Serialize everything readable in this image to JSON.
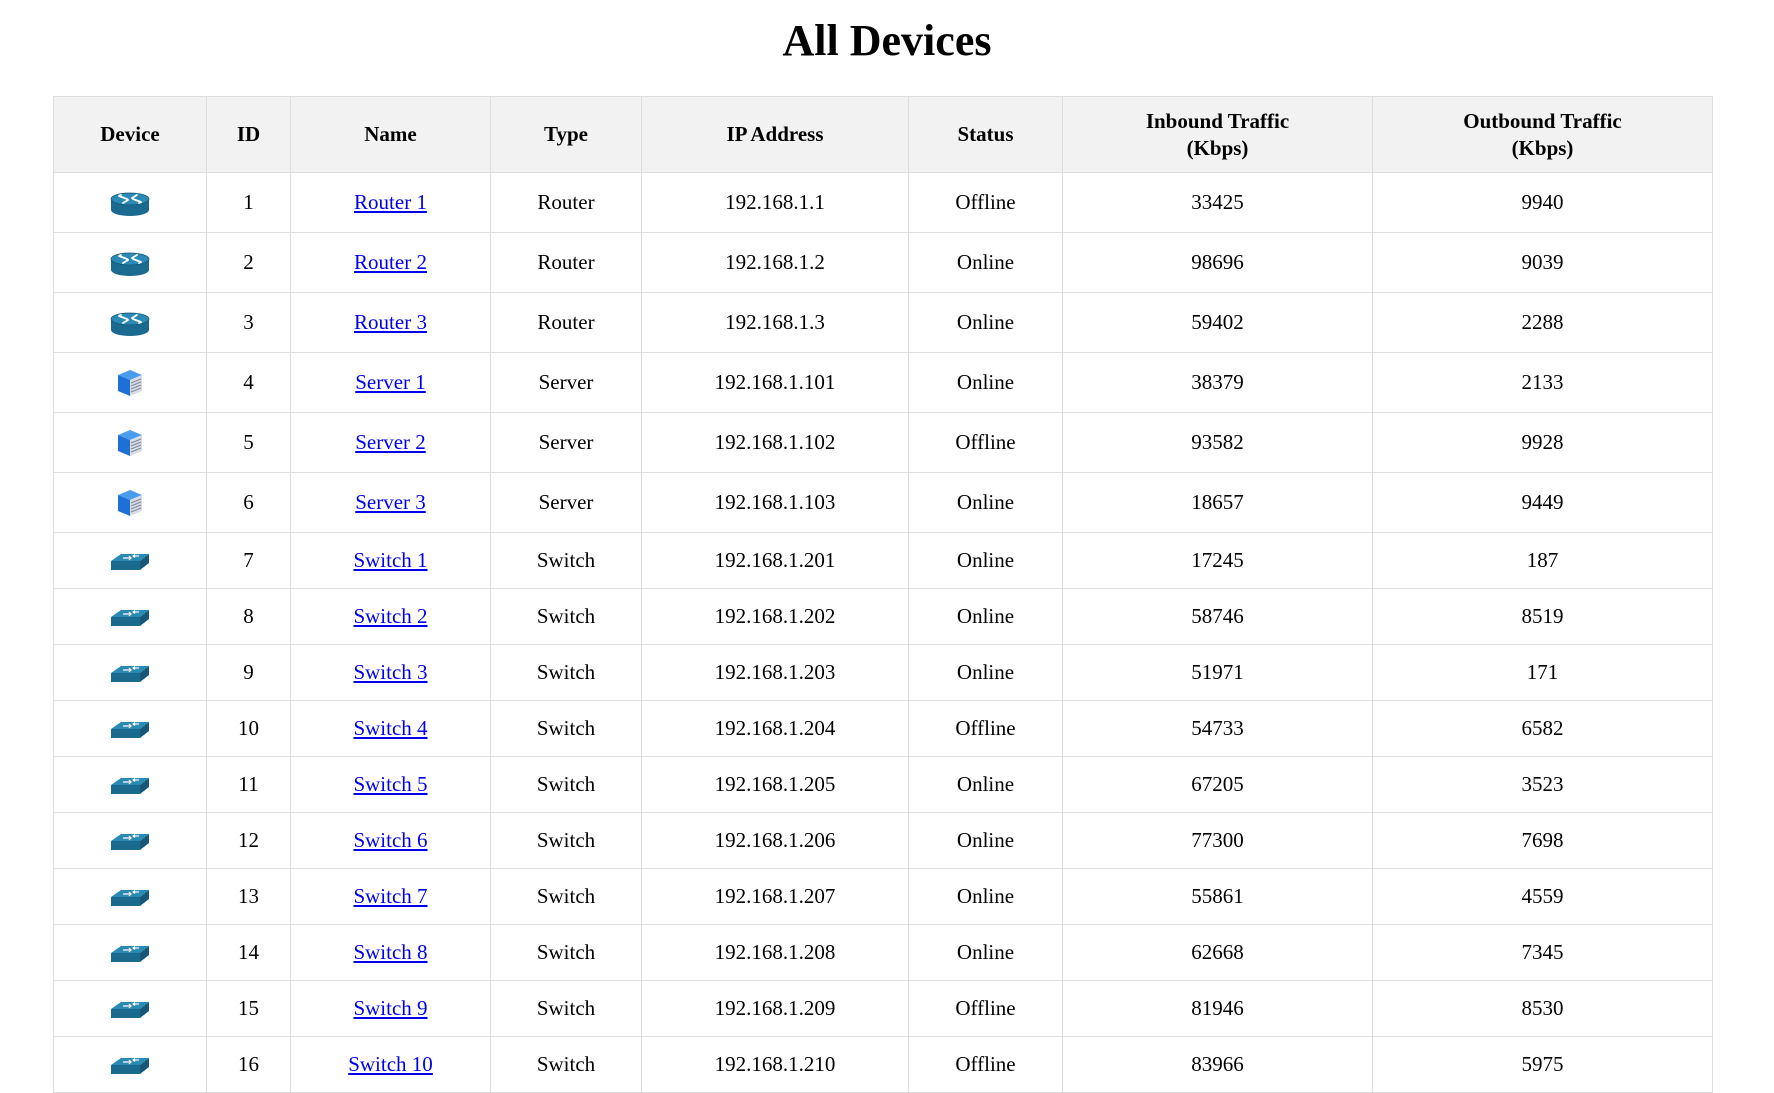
{
  "page": {
    "title": "All Devices"
  },
  "colors": {
    "router": "#1b6a8f",
    "server": "#1e6fd6",
    "switch": "#1b6a8f",
    "link": "#0000ee",
    "header_bg": "#f2f2f2"
  },
  "table": {
    "headers": {
      "device": "Device",
      "id": "ID",
      "name": "Name",
      "type": "Type",
      "ip": "IP Address",
      "status": "Status",
      "inbound_l1": "Inbound Traffic",
      "inbound_l2": "(Kbps)",
      "outbound_l1": "Outbound Traffic",
      "outbound_l2": "(Kbps)"
    },
    "rows": [
      {
        "icon": "router-icon",
        "id": "1",
        "name": "Router 1",
        "type": "Router",
        "ip": "192.168.1.1",
        "status": "Offline",
        "inbound": "33425",
        "outbound": "9940"
      },
      {
        "icon": "router-icon",
        "id": "2",
        "name": "Router 2",
        "type": "Router",
        "ip": "192.168.1.2",
        "status": "Online",
        "inbound": "98696",
        "outbound": "9039"
      },
      {
        "icon": "router-icon",
        "id": "3",
        "name": "Router 3",
        "type": "Router",
        "ip": "192.168.1.3",
        "status": "Online",
        "inbound": "59402",
        "outbound": "2288"
      },
      {
        "icon": "server-icon",
        "id": "4",
        "name": "Server 1",
        "type": "Server",
        "ip": "192.168.1.101",
        "status": "Online",
        "inbound": "38379",
        "outbound": "2133"
      },
      {
        "icon": "server-icon",
        "id": "5",
        "name": "Server 2",
        "type": "Server",
        "ip": "192.168.1.102",
        "status": "Offline",
        "inbound": "93582",
        "outbound": "9928"
      },
      {
        "icon": "server-icon",
        "id": "6",
        "name": "Server 3",
        "type": "Server",
        "ip": "192.168.1.103",
        "status": "Online",
        "inbound": "18657",
        "outbound": "9449"
      },
      {
        "icon": "switch-icon",
        "id": "7",
        "name": "Switch 1",
        "type": "Switch",
        "ip": "192.168.1.201",
        "status": "Online",
        "inbound": "17245",
        "outbound": "187"
      },
      {
        "icon": "switch-icon",
        "id": "8",
        "name": "Switch 2",
        "type": "Switch",
        "ip": "192.168.1.202",
        "status": "Online",
        "inbound": "58746",
        "outbound": "8519"
      },
      {
        "icon": "switch-icon",
        "id": "9",
        "name": "Switch 3",
        "type": "Switch",
        "ip": "192.168.1.203",
        "status": "Online",
        "inbound": "51971",
        "outbound": "171"
      },
      {
        "icon": "switch-icon",
        "id": "10",
        "name": "Switch 4",
        "type": "Switch",
        "ip": "192.168.1.204",
        "status": "Offline",
        "inbound": "54733",
        "outbound": "6582"
      },
      {
        "icon": "switch-icon",
        "id": "11",
        "name": "Switch 5",
        "type": "Switch",
        "ip": "192.168.1.205",
        "status": "Online",
        "inbound": "67205",
        "outbound": "3523"
      },
      {
        "icon": "switch-icon",
        "id": "12",
        "name": "Switch 6",
        "type": "Switch",
        "ip": "192.168.1.206",
        "status": "Online",
        "inbound": "77300",
        "outbound": "7698"
      },
      {
        "icon": "switch-icon",
        "id": "13",
        "name": "Switch 7",
        "type": "Switch",
        "ip": "192.168.1.207",
        "status": "Online",
        "inbound": "55861",
        "outbound": "4559"
      },
      {
        "icon": "switch-icon",
        "id": "14",
        "name": "Switch 8",
        "type": "Switch",
        "ip": "192.168.1.208",
        "status": "Online",
        "inbound": "62668",
        "outbound": "7345"
      },
      {
        "icon": "switch-icon",
        "id": "15",
        "name": "Switch 9",
        "type": "Switch",
        "ip": "192.168.1.209",
        "status": "Offline",
        "inbound": "81946",
        "outbound": "8530"
      },
      {
        "icon": "switch-icon",
        "id": "16",
        "name": "Switch 10",
        "type": "Switch",
        "ip": "192.168.1.210",
        "status": "Offline",
        "inbound": "83966",
        "outbound": "5975"
      }
    ]
  }
}
